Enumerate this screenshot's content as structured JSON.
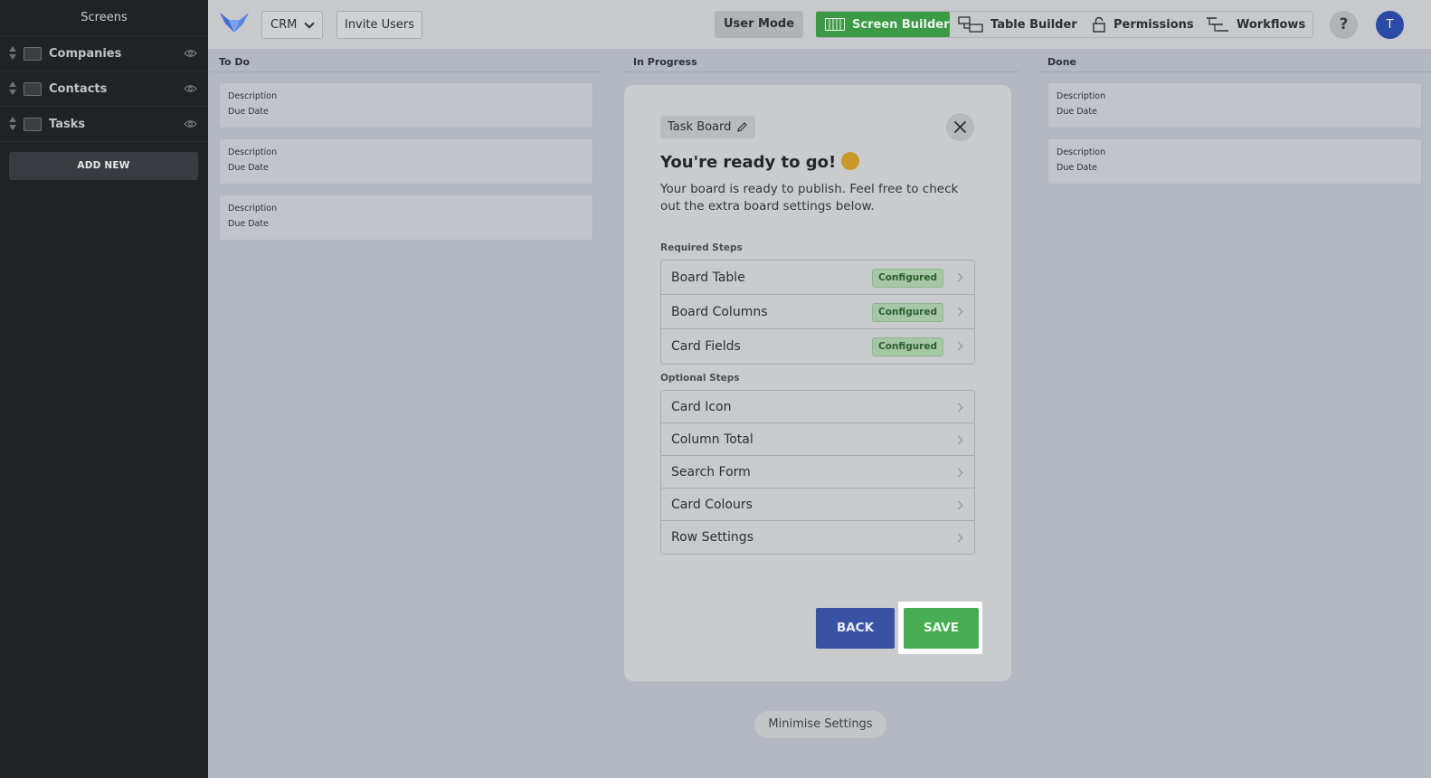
{
  "sidebar": {
    "title": "Screens",
    "screens": [
      {
        "label": "Companies"
      },
      {
        "label": "Contacts"
      },
      {
        "label": "Tasks"
      }
    ],
    "add_new_label": "ADD NEW"
  },
  "topbar": {
    "app_select": "CRM",
    "invite_label": "Invite Users",
    "user_mode_label": "User Mode",
    "nav": {
      "screen_builder": "Screen Builder",
      "table_builder": "Table Builder",
      "permissions": "Permissions",
      "workflows": "Workflows"
    },
    "help_label": "?",
    "avatar_initial": "T"
  },
  "board": {
    "columns": [
      {
        "title": "To Do",
        "cards": [
          {
            "line1": "Description",
            "line2": "Due Date"
          },
          {
            "line1": "Description",
            "line2": "Due Date"
          },
          {
            "line1": "Description",
            "line2": "Due Date"
          }
        ]
      },
      {
        "title": "In Progress",
        "cards": []
      },
      {
        "title": "Done",
        "cards": [
          {
            "line1": "Description",
            "line2": "Due Date"
          },
          {
            "line1": "Description",
            "line2": "Due Date"
          }
        ]
      }
    ]
  },
  "modal": {
    "tag_label": "Task Board",
    "title": "You're ready to go!",
    "description": "Your board is ready to publish. Feel free to check out the extra board settings below.",
    "required_label": "Required Steps",
    "required_steps": [
      {
        "label": "Board Table",
        "status": "Configured"
      },
      {
        "label": "Board Columns",
        "status": "Configured"
      },
      {
        "label": "Card Fields",
        "status": "Configured"
      }
    ],
    "optional_label": "Optional Steps",
    "optional_steps": [
      {
        "label": "Card Icon"
      },
      {
        "label": "Column Total"
      },
      {
        "label": "Search Form"
      },
      {
        "label": "Card Colours"
      },
      {
        "label": "Row Settings"
      }
    ],
    "back_label": "BACK",
    "save_label": "SAVE"
  },
  "minimise_label": "Minimise Settings",
  "colors": {
    "primary_green": "#46ad52",
    "primary_blue": "#3a52a3",
    "sidebar_bg": "#1f2326",
    "badge_green": "#a6c7a6"
  }
}
